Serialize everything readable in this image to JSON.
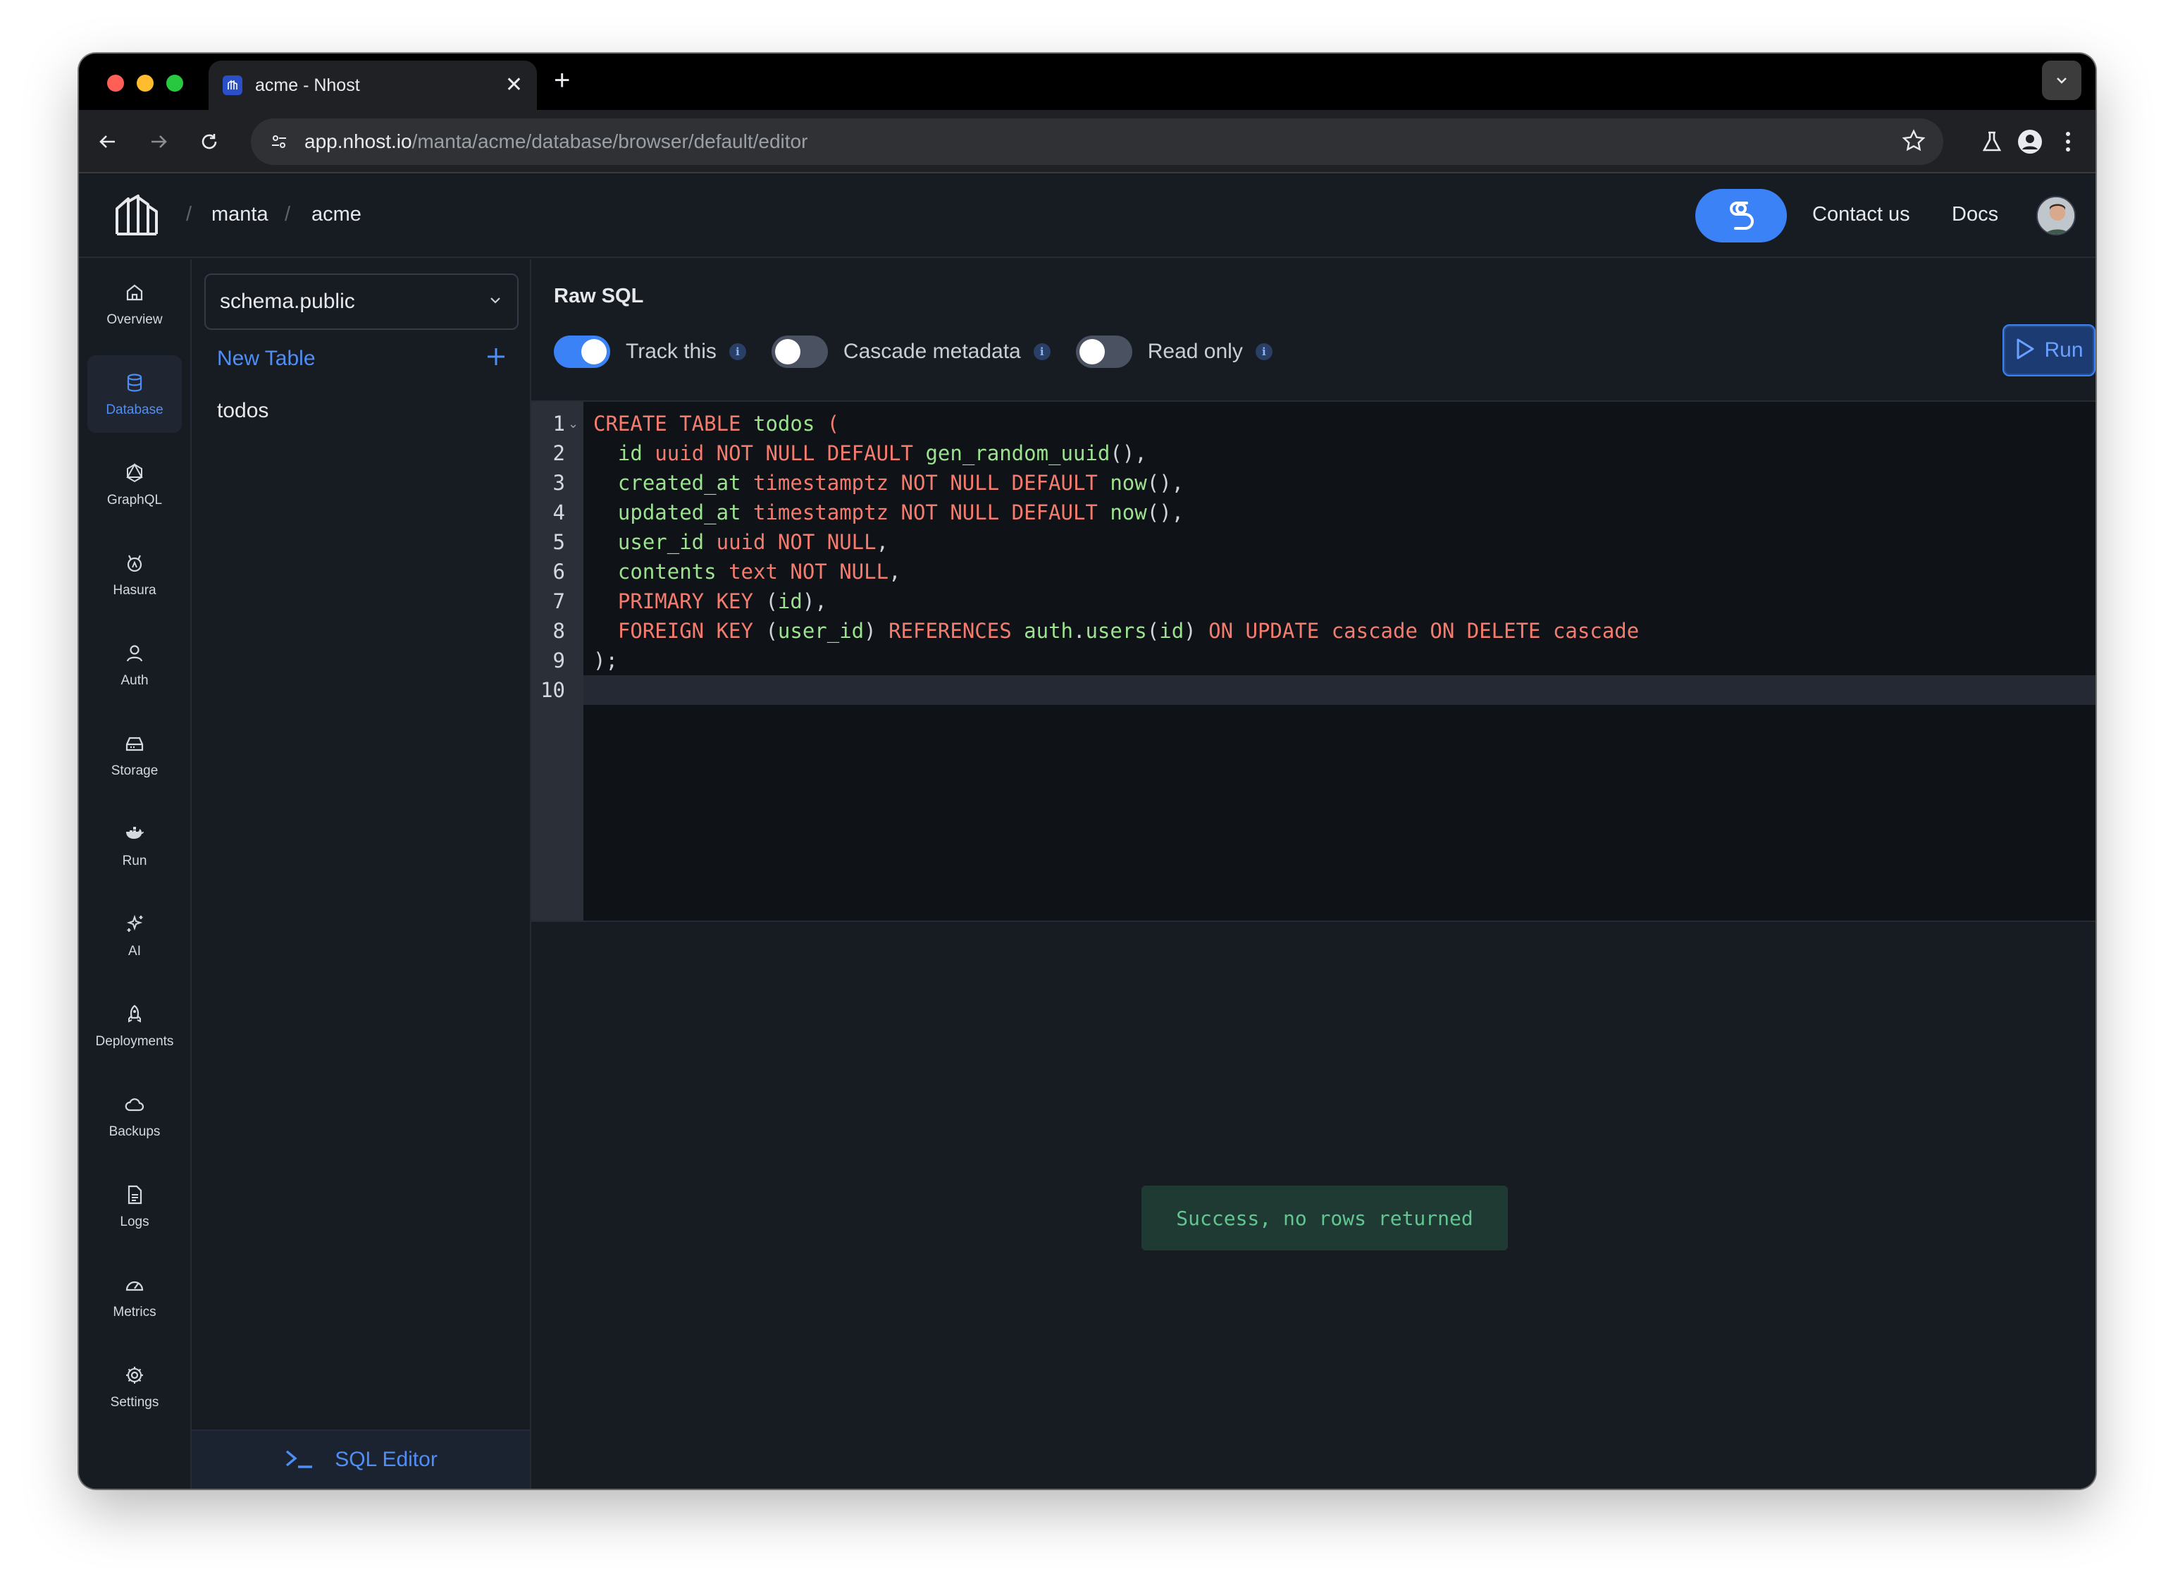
{
  "browser": {
    "tab_title": "acme - Nhost",
    "url_host": "app.nhost.io",
    "url_path": "/manta/acme/database/browser/default/editor"
  },
  "header": {
    "breadcrumb": [
      "manta",
      "acme"
    ],
    "contact_label": "Contact us",
    "docs_label": "Docs"
  },
  "sidenav": {
    "items": [
      {
        "label": "Overview",
        "icon": "home-icon"
      },
      {
        "label": "Database",
        "icon": "database-icon"
      },
      {
        "label": "GraphQL",
        "icon": "graphql-icon"
      },
      {
        "label": "Hasura",
        "icon": "hasura-icon"
      },
      {
        "label": "Auth",
        "icon": "user-icon"
      },
      {
        "label": "Storage",
        "icon": "storage-icon"
      },
      {
        "label": "Run",
        "icon": "docker-icon"
      },
      {
        "label": "AI",
        "icon": "sparkles-icon"
      },
      {
        "label": "Deployments",
        "icon": "rocket-icon"
      },
      {
        "label": "Backups",
        "icon": "cloud-icon"
      },
      {
        "label": "Logs",
        "icon": "file-icon"
      },
      {
        "label": "Metrics",
        "icon": "gauge-icon"
      },
      {
        "label": "Settings",
        "icon": "gear-icon"
      }
    ],
    "active": "Database"
  },
  "tablepanel": {
    "schema": "schema.public",
    "new_table_label": "New Table",
    "tables": [
      "todos"
    ],
    "sql_editor_label": "SQL Editor"
  },
  "editor": {
    "title": "Raw SQL",
    "options": [
      {
        "label": "Track this",
        "on": true
      },
      {
        "label": "Cascade metadata",
        "on": false
      },
      {
        "label": "Read only",
        "on": false
      }
    ],
    "run_label": "Run",
    "line_numbers": [
      "1",
      "2",
      "3",
      "4",
      "5",
      "6",
      "7",
      "8",
      "9",
      "10"
    ],
    "code_lines": [
      "CREATE TABLE todos (",
      "  id uuid NOT NULL DEFAULT gen_random_uuid(),",
      "  created_at timestamptz NOT NULL DEFAULT now(),",
      "  updated_at timestamptz NOT NULL DEFAULT now(),",
      "  user_id uuid NOT NULL,",
      "  contents text NOT NULL,",
      "  PRIMARY KEY (id),",
      "  FOREIGN KEY (user_id) REFERENCES auth.users(id) ON UPDATE cascade ON DELETE cascade",
      ");",
      ""
    ]
  },
  "result": {
    "message": "Success, no rows returned"
  },
  "colors": {
    "accent": "#3b82f6",
    "keyword": "#f47c6f",
    "identifier": "#9be38f",
    "success": "#62c692"
  }
}
